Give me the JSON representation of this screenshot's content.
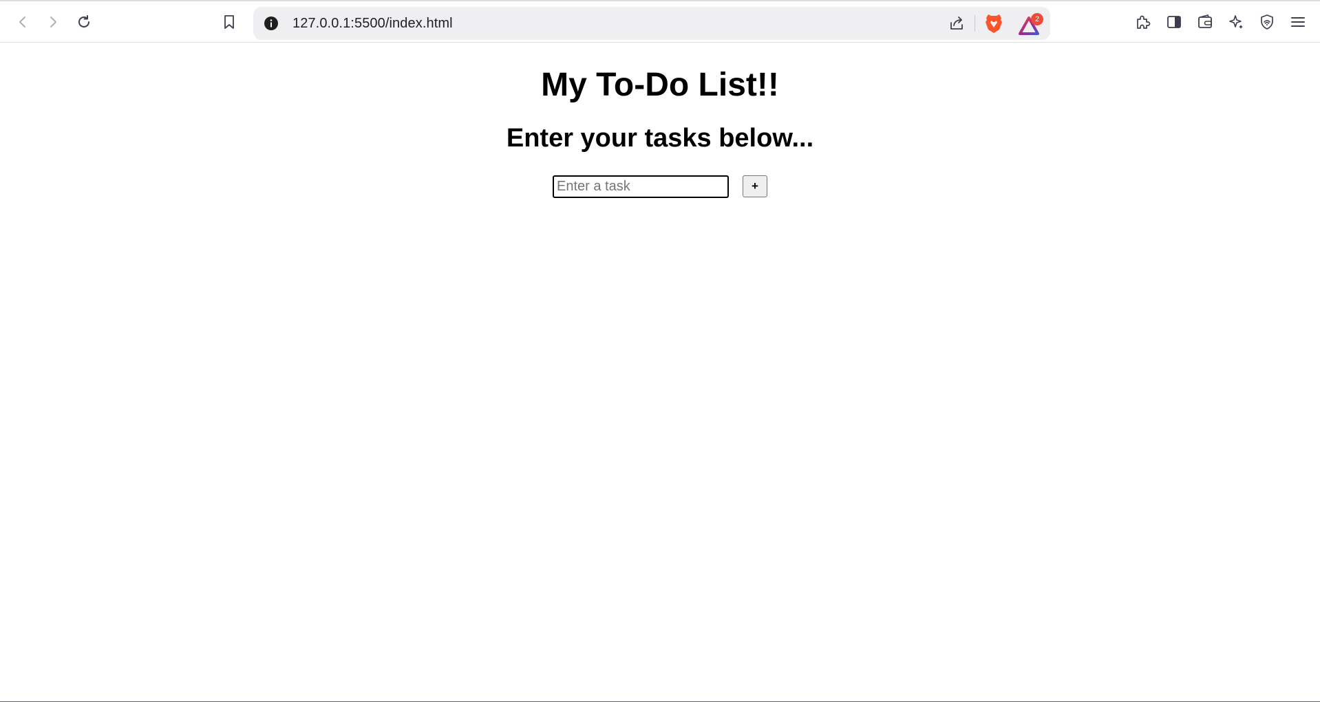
{
  "browser": {
    "url": "127.0.0.1:5500/index.html",
    "rewards_badge": "2",
    "icons": {
      "back": "arrow-left-icon",
      "forward": "arrow-right-icon",
      "reload": "reload-icon",
      "bookmark": "bookmark-icon",
      "site_info": "info-icon",
      "share": "share-icon",
      "brave_shields": "brave-lion-icon",
      "rewards": "brave-rewards-triangle-icon",
      "extensions": "puzzle-icon",
      "sidebar": "sidebar-icon",
      "wallet": "wallet-icon",
      "leo": "sparkle-icon",
      "vpn": "shield-icon",
      "menu": "hamburger-menu-icon"
    },
    "colors": {
      "omnibox_bg": "#efeff2",
      "brave_orange": "#fb542b",
      "rewards_purple": "#6b2fa0",
      "badge_red": "#ee4a37"
    }
  },
  "page": {
    "title": "My To-Do List!!",
    "subtitle": "Enter your tasks below...",
    "task_input": {
      "value": "",
      "placeholder": "Enter a task"
    },
    "add_button_label": "+"
  }
}
